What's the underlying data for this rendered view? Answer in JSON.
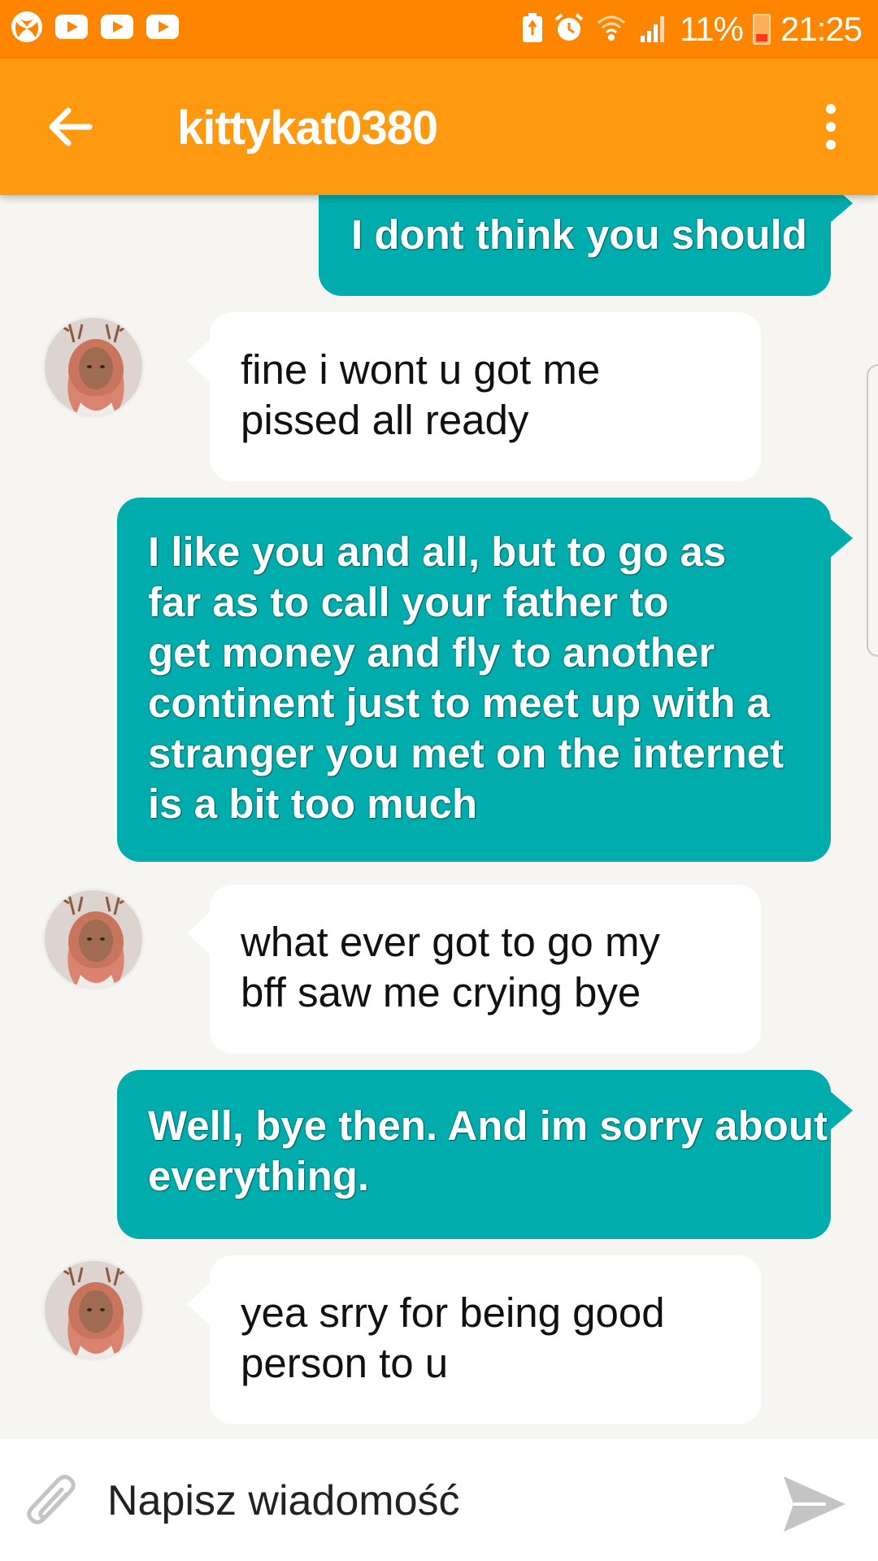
{
  "status_bar": {
    "battery_percent": "11%",
    "time": "21:25",
    "left_icons": [
      "xbox-icon",
      "youtube-icon",
      "youtube-icon",
      "youtube-icon"
    ],
    "right_icons": [
      "battery-saver-icon",
      "alarm-icon",
      "wifi-icon",
      "signal-icon"
    ]
  },
  "app_bar": {
    "title": "kittykat0380",
    "back_icon": "arrow-left-icon",
    "menu_icon": "more-vert-icon"
  },
  "messages": [
    {
      "side": "out",
      "text": "I dont think you should"
    },
    {
      "side": "in",
      "text": "fine i wont u got me\npissed all ready"
    },
    {
      "side": "out",
      "text": "I like you and all, but to go as\nfar as to call your father to\nget money and fly to another\ncontinent just to meet up with a\nstranger you met on the internet\nis a bit too much"
    },
    {
      "side": "in",
      "text": "what ever got to go my\nbff saw me crying bye"
    },
    {
      "side": "out",
      "text": "Well, bye then. And im sorry about\neverything."
    },
    {
      "side": "in",
      "text": "yea srry for being good\nperson to u"
    }
  ],
  "input": {
    "placeholder": "Napisz wiadomość",
    "attach_icon": "paperclip-icon",
    "send_icon": "send-icon"
  },
  "colors": {
    "status_bar": "#fe8500",
    "app_bar": "#ff9910",
    "outgoing_bubble": "#00acac",
    "incoming_bubble": "#ffffff",
    "background": "#f6f5f1"
  }
}
